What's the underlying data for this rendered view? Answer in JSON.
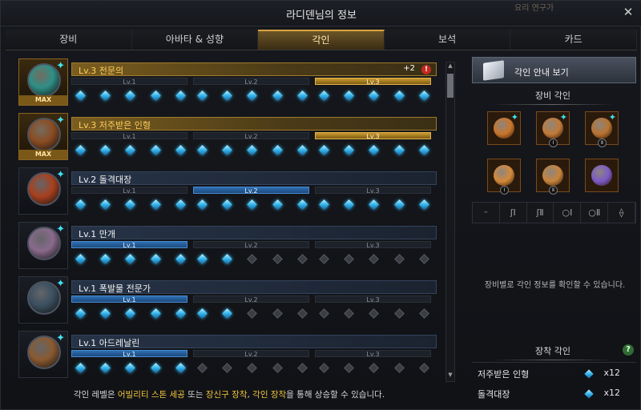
{
  "window": {
    "title": "라디덴님의 정보",
    "ghost_text": "요리 연구가"
  },
  "tabs": [
    {
      "label": "장비",
      "active": false
    },
    {
      "label": "아바타 & 성향",
      "active": false
    },
    {
      "label": "각인",
      "active": true
    },
    {
      "label": "보석",
      "active": false
    },
    {
      "label": "카드",
      "active": false
    }
  ],
  "engravings": [
    {
      "name": "Lv.3 전문의",
      "max": true,
      "max_label": "MAX",
      "bonus": "+2",
      "alert": "!",
      "level_labels": [
        "Lv.1",
        "Lv.2",
        "Lv.3"
      ],
      "active_level": 3,
      "filled_gems": 15,
      "orb_color": "#2f8f86"
    },
    {
      "name": "Lv.3 저주받은 인형",
      "max": true,
      "max_label": "MAX",
      "bonus": "",
      "alert": "",
      "level_labels": [
        "Lv.1",
        "Lv.2",
        "Lv.3"
      ],
      "active_level": 3,
      "filled_gems": 15,
      "orb_color": "#8a4c22"
    },
    {
      "name": "Lv.2 돌격대장",
      "max": false,
      "max_label": "",
      "bonus": "",
      "alert": "",
      "level_labels": [
        "Lv.1",
        "Lv.2",
        "Lv.3"
      ],
      "active_level": 2,
      "filled_gems": 15,
      "orb_color": "#a8401e"
    },
    {
      "name": "Lv.1 만개",
      "max": false,
      "max_label": "",
      "bonus": "",
      "alert": "",
      "level_labels": [
        "Lv.1",
        "Lv.2",
        "Lv.3"
      ],
      "active_level": 1,
      "filled_gems": 7,
      "orb_color": "#8a6a8c"
    },
    {
      "name": "Lv.1 폭발물 전문가",
      "max": false,
      "max_label": "",
      "bonus": "",
      "alert": "",
      "level_labels": [
        "Lv.1",
        "Lv.2",
        "Lv.3"
      ],
      "active_level": 1,
      "filled_gems": 7,
      "orb_color": "#3b5060"
    },
    {
      "name": "Lv.1 아드레날린",
      "max": false,
      "max_label": "",
      "bonus": "",
      "alert": "",
      "level_labels": [
        "Lv.1",
        "Lv.2",
        "Lv.3"
      ],
      "active_level": 1,
      "filled_gems": 5,
      "orb_color": "#8a5a30"
    }
  ],
  "footer": {
    "prefix": "각인 레벨은 ",
    "hl1": "어빌리티 스톤 세공",
    "mid1": " 또는 ",
    "hl2": "장신구 장착",
    "mid2": ", ",
    "hl3": "각인 장착",
    "suffix": "을 통해 상승할 수 있습니다."
  },
  "right": {
    "guide_button": "각인 안내 보기",
    "equipment_title": "장비 각인",
    "equipment": [
      {
        "icon": "necklace-icon",
        "roman": "",
        "special": true,
        "color": "#c9762a"
      },
      {
        "icon": "earring-icon",
        "roman": "Ⅰ",
        "special": true,
        "color": "#c27a38"
      },
      {
        "icon": "earring-icon",
        "roman": "Ⅱ",
        "special": true,
        "color": "#b8732f"
      },
      {
        "icon": "ring-icon",
        "roman": "Ⅰ",
        "special": false,
        "color": "#d4893a"
      },
      {
        "icon": "ring-icon",
        "roman": "Ⅱ",
        "special": false,
        "color": "#c8843c"
      },
      {
        "icon": "ability-stone-icon",
        "roman": "",
        "special": false,
        "color": "#7b5ac8"
      }
    ],
    "slot_icons": [
      "ᵕ",
      "ʃⅠ",
      "ʃⅡ",
      "○Ⅰ",
      "○Ⅱ",
      "⟠"
    ],
    "info_text": "장비별로 각인 정보를 확인할 수 있습니다.",
    "equip_engr_title": "장착 각인",
    "help": "?",
    "equipped": [
      {
        "name": "저주받은 인형",
        "count": "x12"
      },
      {
        "name": "돌격대장",
        "count": "x12"
      }
    ]
  }
}
